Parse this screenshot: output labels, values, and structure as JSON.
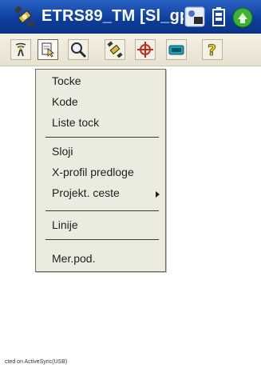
{
  "window": {
    "title": "ETRS89_TM [Sl_gpr"
  },
  "toolbar": {
    "buttons": [
      {
        "icon": "antenna-icon"
      },
      {
        "icon": "document-pointer-icon",
        "pressed": true
      },
      {
        "icon": "magnifier-icon"
      },
      {
        "icon": "satellite-icon"
      },
      {
        "icon": "crosshair-icon"
      },
      {
        "icon": "keyboard-icon"
      },
      {
        "icon": "help-icon",
        "glyph": "?"
      }
    ]
  },
  "menu": {
    "items": [
      {
        "label": "Tocke"
      },
      {
        "label": "Kode"
      },
      {
        "label": "Liste tock"
      },
      {
        "label": "Sloji"
      },
      {
        "label": "X-profil predloge"
      },
      {
        "label": "Projekt. ceste",
        "submenu": true
      },
      {
        "label": "Linije"
      },
      {
        "label": "Mer.pod."
      }
    ]
  },
  "status": {
    "text": "cted on ActiveSync(USB)"
  },
  "colors": {
    "titlebar": "#0d3f9e",
    "menu_bg": "#ecebdf",
    "toolbar_bg": "#ece7d7"
  }
}
